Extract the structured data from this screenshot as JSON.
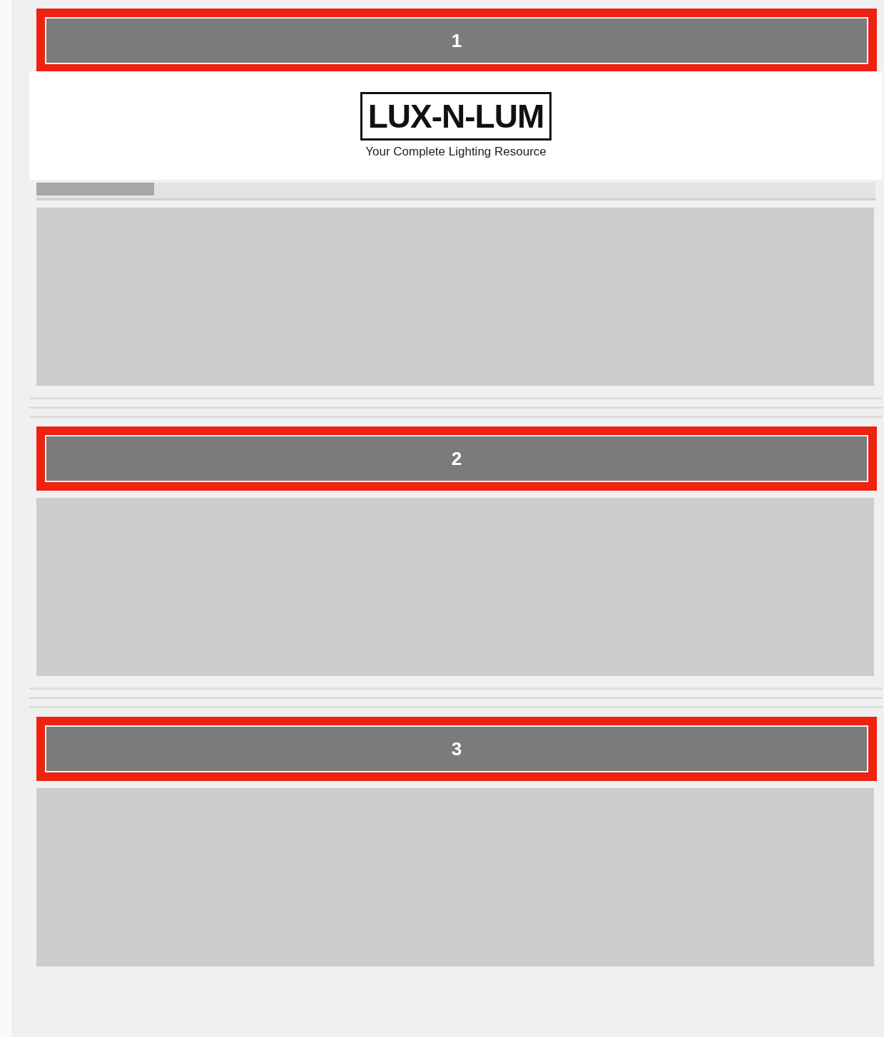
{
  "sections": [
    {
      "banner": "1",
      "header": {
        "logo": "LUX-N-LUM",
        "tagline": "Your Complete Lighting Resource"
      }
    },
    {
      "banner": "2"
    },
    {
      "banner": "3"
    }
  ]
}
